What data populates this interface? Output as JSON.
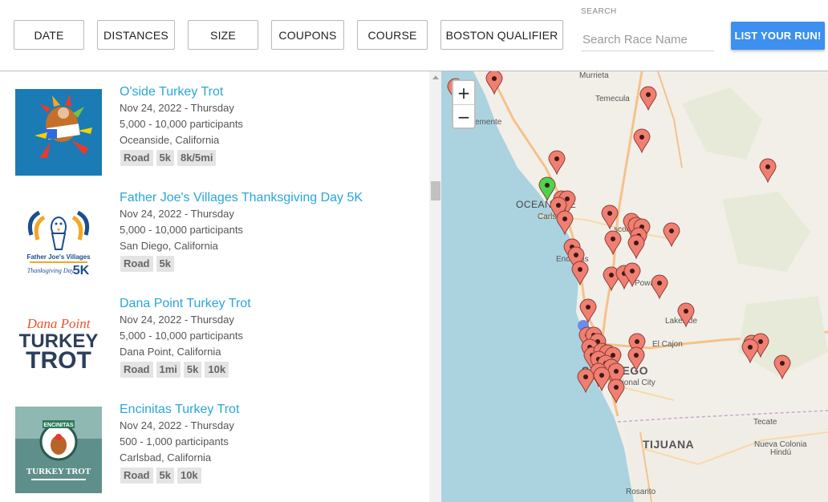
{
  "filters": {
    "date": "DATE",
    "distances": "DISTANCES",
    "size": "SIZE",
    "coupons": "COUPONS",
    "course": "COURSE",
    "boston": "BOSTON QUALIFIER"
  },
  "search": {
    "label": "SEARCH",
    "placeholder": "Search Race Name",
    "value": ""
  },
  "list_run_label": "LIST YOUR RUN!",
  "races": [
    {
      "title": "O'side Turkey Trot",
      "date": "Nov 24, 2022 - Thursday",
      "participants": "5,000 - 10,000 participants",
      "location": "Oceanside, California",
      "tags": [
        "Road",
        "5k",
        "8k/5mi"
      ]
    },
    {
      "title": "Father Joe's Villages Thanksgiving Day 5K",
      "date": "Nov 24, 2022 - Thursday",
      "participants": "5,000 - 10,000 participants",
      "location": "San Diego, California",
      "tags": [
        "Road",
        "5k"
      ],
      "logo_text": {
        "line1": "Father Joe's Villages",
        "line2": "Thanksgiving Day",
        "line3": "5K"
      }
    },
    {
      "title": "Dana Point Turkey Trot",
      "date": "Nov 24, 2022 - Thursday",
      "participants": "5,000 - 10,000 participants",
      "location": "Dana Point, California",
      "tags": [
        "Road",
        "1mi",
        "5k",
        "10k"
      ],
      "logo_text": {
        "line1": "Dana Point",
        "line2": "TURKEY",
        "line3": "TROT"
      }
    },
    {
      "title": "Encinitas Turkey Trot",
      "date": "Nov 24, 2022 - Thursday",
      "participants": "500 - 1,000 participants",
      "location": "Carlsbad, California",
      "tags": [
        "Road",
        "5k",
        "10k"
      ],
      "logo_text": {
        "line1": "ENCINITAS",
        "line2": "TURKEY TROT"
      }
    }
  ],
  "map": {
    "zoom_in": "+",
    "zoom_out": "−",
    "labels": {
      "murrieta": "Murrieta",
      "temecula": "Temecula",
      "temecula_partial": "emente",
      "oceanside": "OCEANSIDE",
      "carlsbad": "Carlsbad",
      "encinitas": "Encinitas",
      "escondido": "scondido",
      "poway": "Poway",
      "lakeside": "Lakeside",
      "el_cajon": "El Cajon",
      "san_diego": "SAN DIEGO",
      "national_city": "National City",
      "tecate": "Tecate",
      "tijuana": "TIJUANA",
      "nueva_colonia": "Nueva Colonia",
      "hindu": "Hindú",
      "rosarito": "Rosarito"
    },
    "colors": {
      "pin_red": "#f07f72",
      "pin_green": "#4cd44c",
      "pin_blue": "#6c8de8",
      "ocean": "#aad3df",
      "land": "#f2efe9"
    }
  }
}
